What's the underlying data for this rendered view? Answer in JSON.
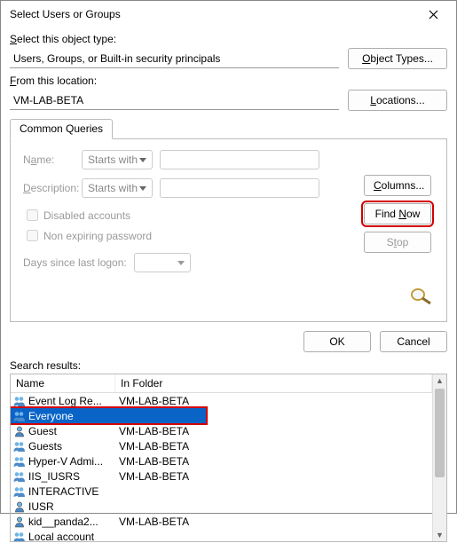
{
  "title": "Select Users or Groups",
  "labels": {
    "select_type": "Select this object type:",
    "from_location": "From this location:",
    "search_results": "Search results:"
  },
  "fields": {
    "object_type": "Users, Groups, or Built-in security principals",
    "location": "VM-LAB-BETA"
  },
  "buttons": {
    "object_types": "Object Types...",
    "locations": "Locations...",
    "columns": "Columns...",
    "find_now": "Find Now",
    "stop": "Stop",
    "ok": "OK",
    "cancel": "Cancel"
  },
  "tab": {
    "label": "Common Queries"
  },
  "query": {
    "name_label": "Name:",
    "desc_label": "Description:",
    "starts_with": "Starts with",
    "disabled_accounts": "Disabled accounts",
    "non_expiring": "Non expiring password",
    "days_logon": "Days since last logon:"
  },
  "columns": {
    "name": "Name",
    "folder": "In Folder"
  },
  "results": [
    {
      "name": "Event Log Re...",
      "folder": "VM-LAB-BETA",
      "type": "group"
    },
    {
      "name": "Everyone",
      "folder": "",
      "type": "group",
      "selected": true
    },
    {
      "name": "Guest",
      "folder": "VM-LAB-BETA",
      "type": "user"
    },
    {
      "name": "Guests",
      "folder": "VM-LAB-BETA",
      "type": "group"
    },
    {
      "name": "Hyper-V Admi...",
      "folder": "VM-LAB-BETA",
      "type": "group"
    },
    {
      "name": "IIS_IUSRS",
      "folder": "VM-LAB-BETA",
      "type": "group"
    },
    {
      "name": "INTERACTIVE",
      "folder": "",
      "type": "group"
    },
    {
      "name": "IUSR",
      "folder": "",
      "type": "user"
    },
    {
      "name": "kid__panda2...",
      "folder": "VM-LAB-BETA",
      "type": "user"
    },
    {
      "name": "Local account",
      "folder": "",
      "type": "group"
    }
  ]
}
